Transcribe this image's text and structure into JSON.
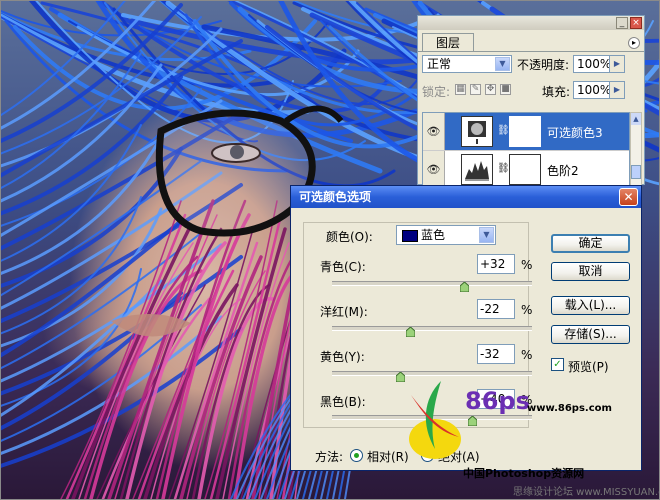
{
  "layers_panel": {
    "tab": "图层",
    "blend_mode": "正常",
    "opacity_label": "不透明度:",
    "opacity_value": "100%",
    "lock_label": "锁定:",
    "fill_label": "填充:",
    "fill_value": "100%",
    "layers": [
      {
        "name": "可选颜色3",
        "selected": true
      },
      {
        "name": "色阶2",
        "selected": false
      }
    ]
  },
  "dialog": {
    "title": "可选颜色选项",
    "color_label": "颜色(O):",
    "color_value": "蓝色",
    "color_swatch": "#000080",
    "sliders": [
      {
        "label": "青色(C):",
        "value": "+32",
        "unit": "%",
        "amount": 32
      },
      {
        "label": "洋红(M):",
        "value": "-22",
        "unit": "%",
        "amount": -22
      },
      {
        "label": "黄色(Y):",
        "value": "-32",
        "unit": "%",
        "amount": -32
      },
      {
        "label": "黑色(B):",
        "value": "+40",
        "unit": "%",
        "amount": 40
      }
    ],
    "buttons": {
      "ok": "确定",
      "cancel": "取消",
      "load": "载入(L)...",
      "save": "存储(S)..."
    },
    "preview_label": "预览(P)",
    "preview_checked": true,
    "method_label": "方法:",
    "method_relative": "相对(R)",
    "method_absolute": "绝对(A)",
    "method_selected": "relative"
  },
  "watermark": {
    "logo": "86ps",
    "url": "www.86ps.com",
    "site_name": "中国Photoshop资源网",
    "corner_text": "思缘设计论坛 www.MISSYUAN.com"
  },
  "colors": {
    "accent": "#316ac5",
    "title_bar": "#2a5fd8",
    "dialog_bg": "#ece9d8"
  }
}
